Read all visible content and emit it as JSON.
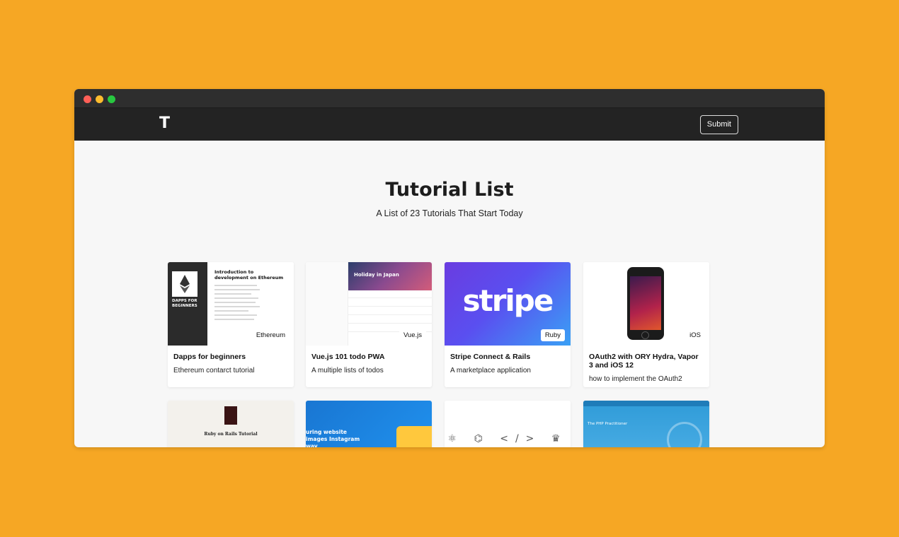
{
  "navbar": {
    "logo": "T",
    "submit_label": "Submit"
  },
  "header": {
    "title": "Tutorial List",
    "subtitle": "A List of 23 Tutorials That Start Today"
  },
  "cards": [
    {
      "title": "Dapps for beginners",
      "description": "Ethereum contarct tutorial",
      "tag": "Ethereum",
      "image": {
        "side_text": "DAPPS FOR BEGINNERS",
        "heading": "Introduction to development on Ethereum"
      }
    },
    {
      "title": "Vue.js 101 todo PWA",
      "description": "A multiple lists of todos",
      "tag": "Vue.js",
      "image": {
        "hero_text": "Holiday in Japan"
      }
    },
    {
      "title": "Stripe Connect & Rails",
      "description": "A marketplace application",
      "tag": "Ruby",
      "image": {
        "logo_text": "stripe"
      }
    },
    {
      "title": "OAuth2 with ORY Hydra, Vapor 3 and iOS 12",
      "description": "how to implement the OAuth2",
      "tag": "iOS"
    },
    {
      "image": {
        "heading": "Ruby on Rails Tutorial"
      }
    },
    {
      "image": {
        "hero_text": "uring website images Instagram way"
      }
    },
    {
      "image": {
        "icons": "⚛ ⌬ </> ♛"
      }
    },
    {
      "image": {
        "heading": "The PHP Practitioner"
      }
    }
  ],
  "colors": {
    "page_background": "#f6a724",
    "navbar": "#232323",
    "window": "#f7f7f7"
  }
}
